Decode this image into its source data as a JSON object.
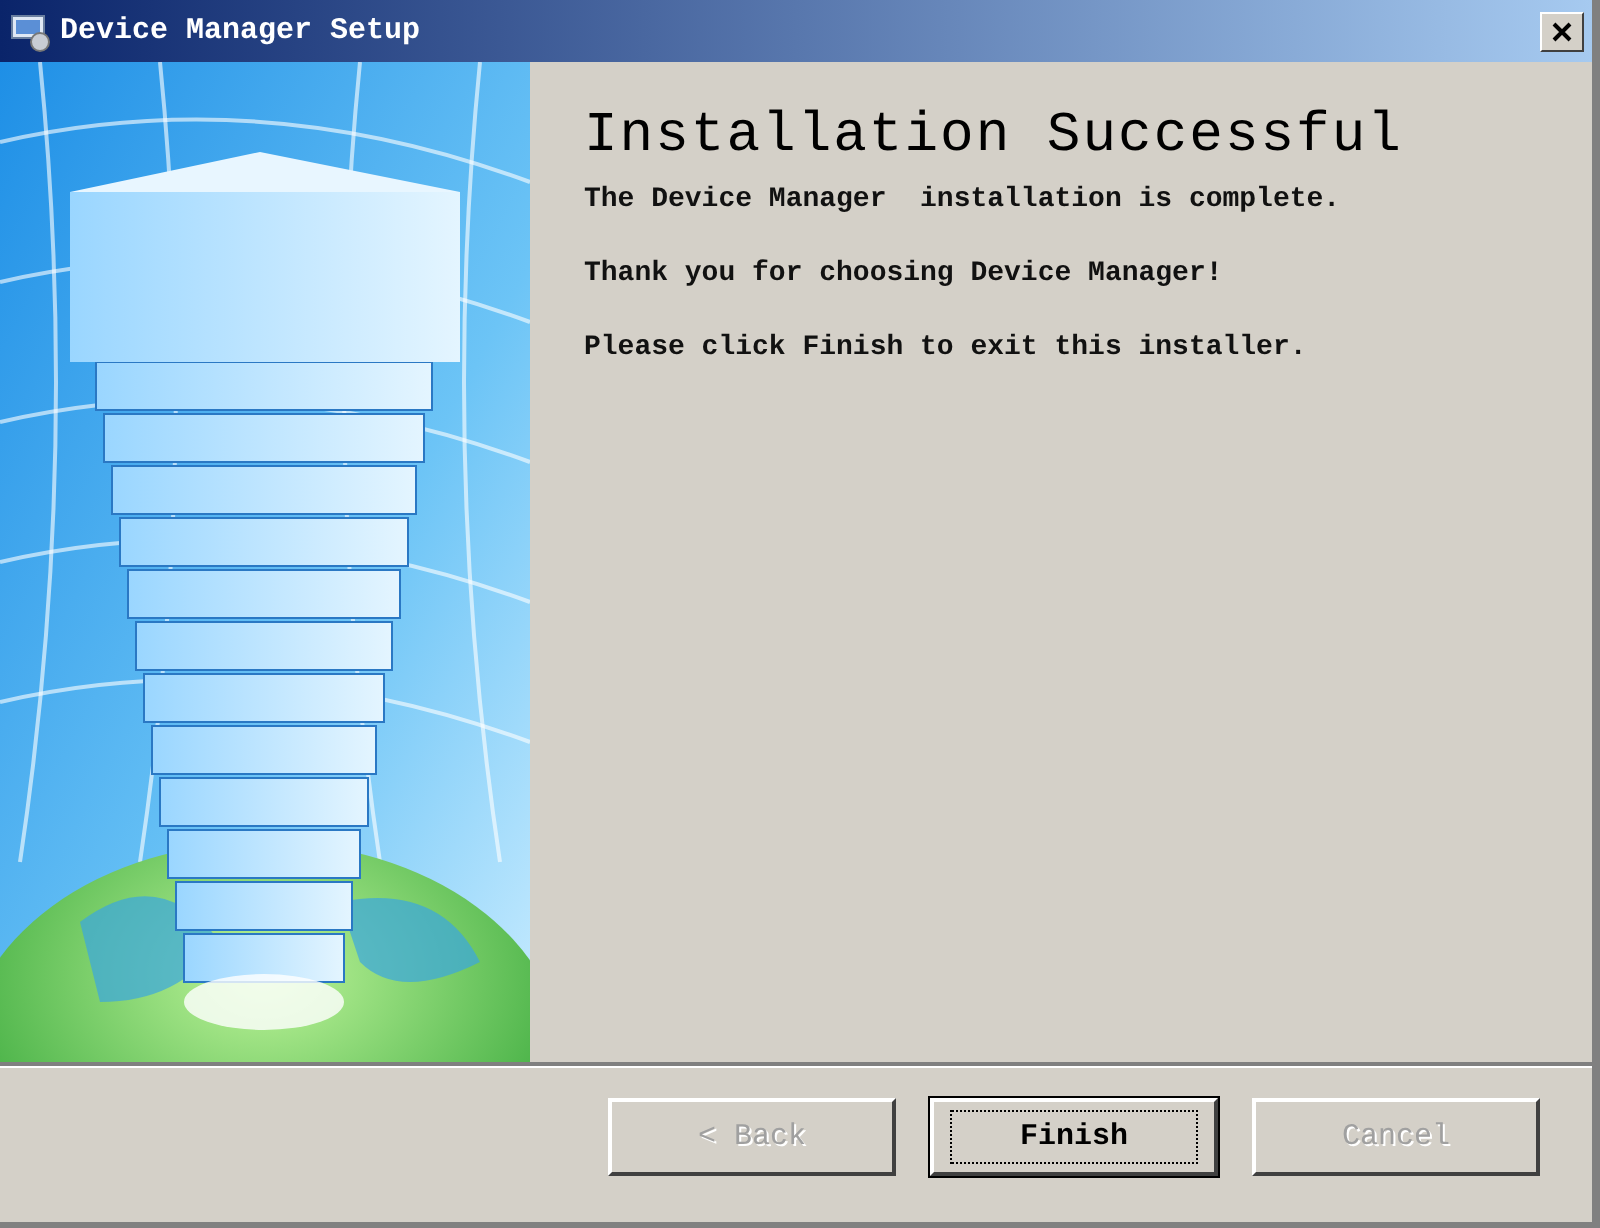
{
  "window": {
    "title": "Device Manager Setup"
  },
  "heading": "Installation Successful",
  "paragraphs": [
    "The Device Manager  installation is complete.",
    "Thank you for choosing Device Manager!",
    "Please click Finish to exit this installer."
  ],
  "buttons": [
    {
      "label": "< Back",
      "disabled": true,
      "default": false
    },
    {
      "label": "Finish",
      "disabled": false,
      "default": true
    },
    {
      "label": "Cancel",
      "disabled": true,
      "default": false
    }
  ]
}
